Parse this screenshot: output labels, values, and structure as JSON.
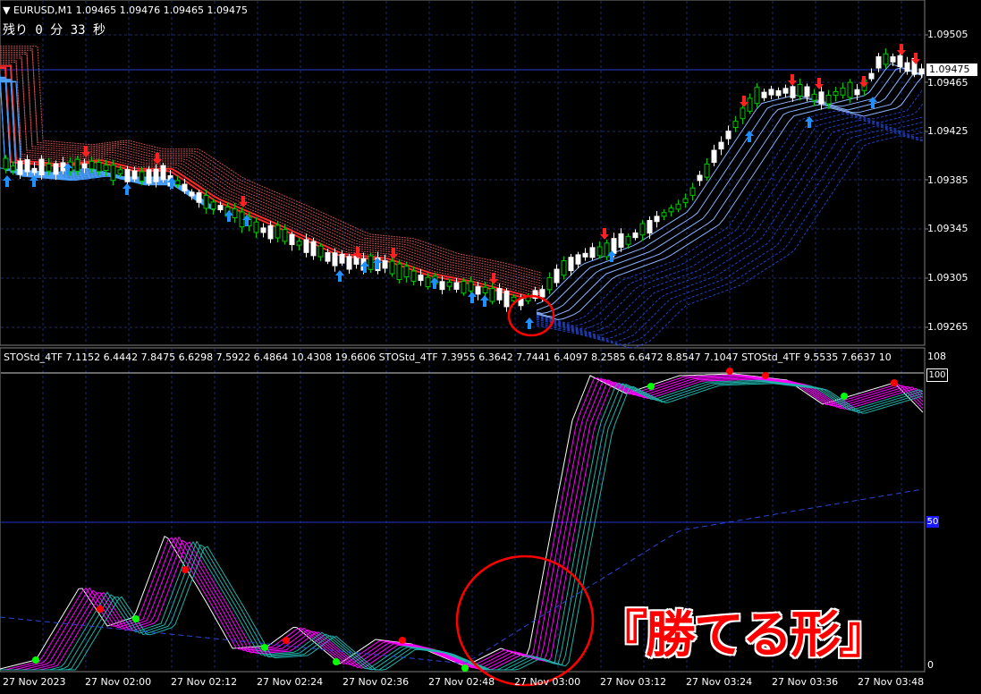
{
  "header": {
    "symbol_text": "EURUSD,M1  1.09465 1.09476 1.09465 1.09475",
    "countdown": "残り 0 分 33 秒"
  },
  "price_axis": {
    "ticks": [
      "1.09505",
      "1.09465",
      "1.09425",
      "1.09385",
      "1.09345",
      "1.09305",
      "1.09265"
    ],
    "current_price": "1.09475"
  },
  "indicator": {
    "label": "STOStd_4TF 7.1152 6.4442 7.8475 6.6298 7.5922 6.4864 10.4308 19.6606  STOStd_4TF 7.3955 6.3642 7.7441 6.4097 8.2585 6.6472 8.8547 7.1047  STOStd_4TF 9.5535 7.6637 10",
    "axis_top": "108",
    "axis_100": "100",
    "axis_50": "50",
    "axis_0": "0"
  },
  "time_axis": [
    "27 Nov 2023",
    "27 Nov 02:00",
    "27 Nov 02:12",
    "27 Nov 02:24",
    "27 Nov 02:36",
    "27 Nov 02:48",
    "27 Nov 03:00",
    "27 Nov 03:12",
    "27 Nov 03:24",
    "27 Nov 03:36",
    "27 Nov 03:48"
  ],
  "caption": "『勝てる形』",
  "colors": {
    "background": "#000000",
    "grid": "#1c2a7a",
    "bull_candle": "#00c800",
    "bear_candle": "#ffffff",
    "up_arrow": "#1e90ff",
    "down_arrow": "#ff2020",
    "highlight_circle": "#ff0000",
    "stoch_magenta": "#ff00ff",
    "stoch_teal": "#20b2aa",
    "dot_red": "#ff0000",
    "dot_green": "#00ff00"
  }
}
